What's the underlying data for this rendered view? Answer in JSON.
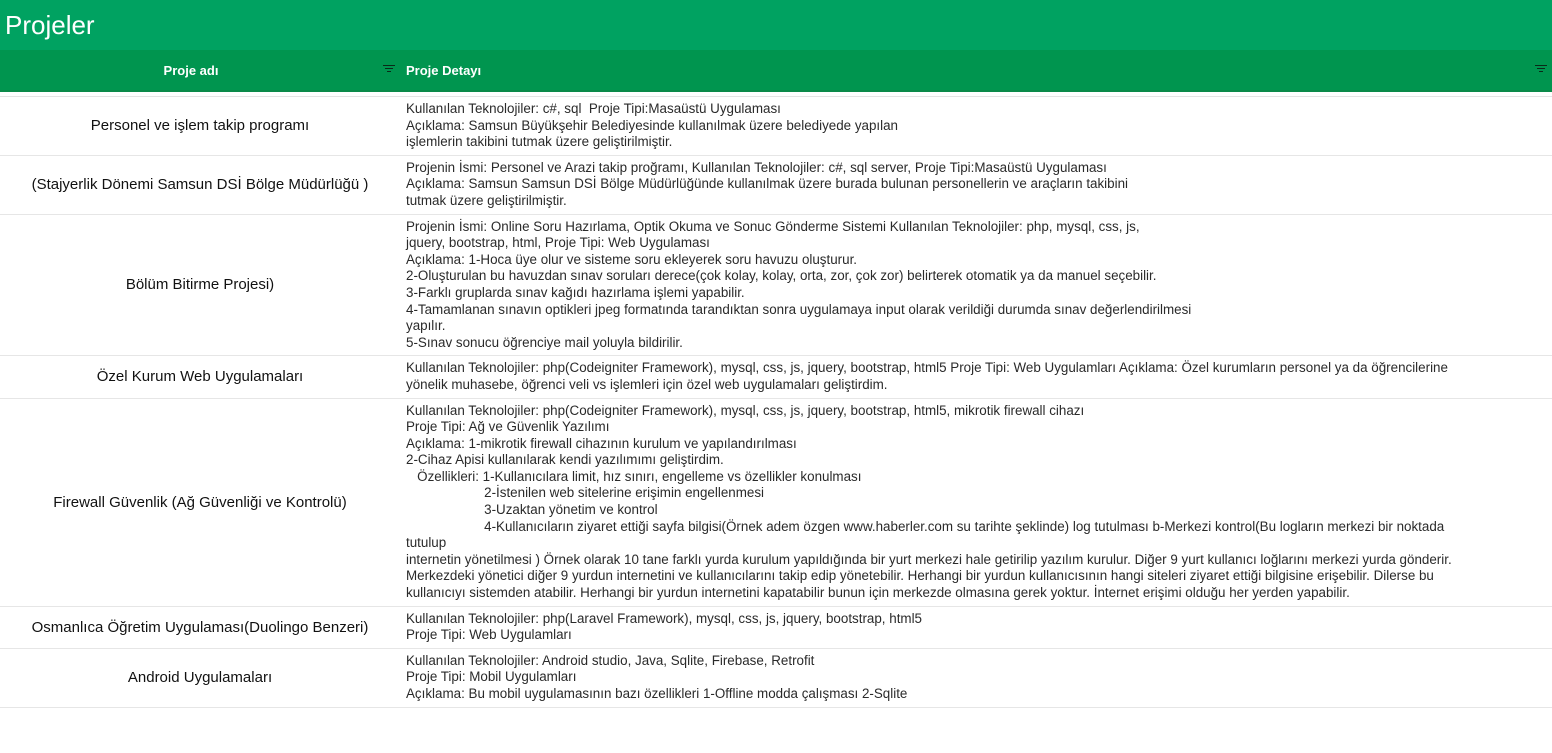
{
  "page": {
    "title": "Projeler"
  },
  "table": {
    "headers": [
      "Proje adı",
      "Proje Detayı"
    ],
    "rows": [
      {
        "name": "Personel ve işlem takip programı",
        "lines": [
          "Kullanılan Teknolojiler: c#, sql  Proje Tipi:Masaüstü Uygulaması",
          "Açıklama: Samsun Büyükşehir Belediyesinde kullanılmak üzere belediyede yapılan",
          "işlemlerin takibini tutmak üzere geliştirilmiştir."
        ]
      },
      {
        "name": "(Stajyerlik Dönemi Samsun DSİ Bölge Müdürlüğü )",
        "lines": [
          "Projenin İsmi: Personel ve Arazi takip proğramı, Kullanılan Teknolojiler: c#, sql server, Proje Tipi:Masaüstü Uygulaması",
          "Açıklama: Samsun Samsun DSİ Bölge Müdürlüğünde kullanılmak üzere burada bulunan personellerin ve araçların takibini",
          "tutmak üzere geliştirilmiştir."
        ]
      },
      {
        "name": "Bölüm Bitirme Projesi)",
        "lines": [
          "Projenin İsmi: Online Soru Hazırlama, Optik Okuma ve Sonuc Gönderme Sistemi Kullanılan Teknolojiler: php, mysql, css, js,",
          "jquery, bootstrap, html, Proje Tipi: Web Uygulaması",
          "Açıklama: 1-Hoca üye olur ve sisteme soru ekleyerek soru havuzu oluşturur.",
          "2-Oluşturulan bu havuzdan sınav soruları derece(çok kolay, kolay, orta, zor, çok zor) belirterek otomatik ya da manuel seçebilir.",
          "3-Farklı gruplarda sınav kağıdı hazırlama işlemi yapabilir.",
          "4-Tamamlanan sınavın optikleri jpeg formatında tarandıktan sonra uygulamaya input olarak verildiği durumda sınav değerlendirilmesi",
          "yapılır.",
          "5-Sınav sonucu öğrenciye mail yoluyla bildirilir."
        ]
      },
      {
        "name": "Özel Kurum Web Uygulamaları",
        "lines": [
          "Kullanılan Teknolojiler: php(Codeigniter Framework), mysql, css, js, jquery, bootstrap, html5 Proje Tipi: Web Uygulamları Açıklama: Özel kurumların personel ya da öğrencilerine",
          "yönelik muhasebe, öğrenci veli vs işlemleri için özel web uygulamaları geliştirdim."
        ]
      },
      {
        "name": "Firewall Güvenlik (Ağ Güvenliği ve Kontrolü)",
        "lines": [
          "Kullanılan Teknolojiler: php(Codeigniter Framework), mysql, css, js, jquery, bootstrap, html5, mikrotik firewall cihazı",
          "Proje Tipi: Ağ ve Güvenlik Yazılımı",
          "Açıklama: 1-mikrotik firewall cihazının kurulum ve yapılandırılması",
          "2-Cihaz Apisi kullanılarak kendi yazılımımı geliştirdim.",
          "   Özellikleri: 1-Kullanıcılara limit, hız sınırı, engelleme vs özellikler konulması",
          "                     2-İstenilen web sitelerine erişimin engellenmesi",
          "                     3-Uzaktan yönetim ve kontrol",
          "                     4-Kullanıcıların ziyaret ettiği sayfa bilgisi(Örnek adem özgen www.haberler.com su tarihte şeklinde) log tutulması b-Merkezi kontrol(Bu logların merkezi bir noktada",
          "tutulup",
          "internetin yönetilmesi ) Örnek olarak 10 tane farklı yurda kurulum yapıldığında bir yurt merkezi hale getirilip yazılım kurulur. Diğer 9 yurt kullanıcı loğlarını merkezi yurda gönderir.",
          "Merkezdeki yönetici diğer 9 yurdun internetini ve kullanıcılarını takip edip yönetebilir. Herhangi bir yurdun kullanıcısının hangi siteleri ziyaret ettiği bilgisine erişebilir. Dilerse bu",
          "kullanıcıyı sistemden atabilir. Herhangi bir yurdun internetini kapatabilir bunun için merkezde olmasına gerek yoktur. İnternet erişimi olduğu her yerden yapabilir."
        ]
      },
      {
        "name": "Osmanlıca Öğretim Uygulaması(Duolingo Benzeri)",
        "lines": [
          "Kullanılan Teknolojiler: php(Laravel Framework), mysql, css, js, jquery, bootstrap, html5",
          "Proje Tipi: Web Uygulamları"
        ]
      },
      {
        "name": "Android Uygulamaları",
        "lines": [
          "Kullanılan Teknolojiler: Android studio, Java, Sqlite, Firebase, Retrofit",
          "Proje Tipi: Mobil Uygulamları",
          "Açıklama: Bu mobil uygulamasının bazı özellikleri 1-Offline modda çalışması 2-Sqlite"
        ]
      }
    ]
  }
}
